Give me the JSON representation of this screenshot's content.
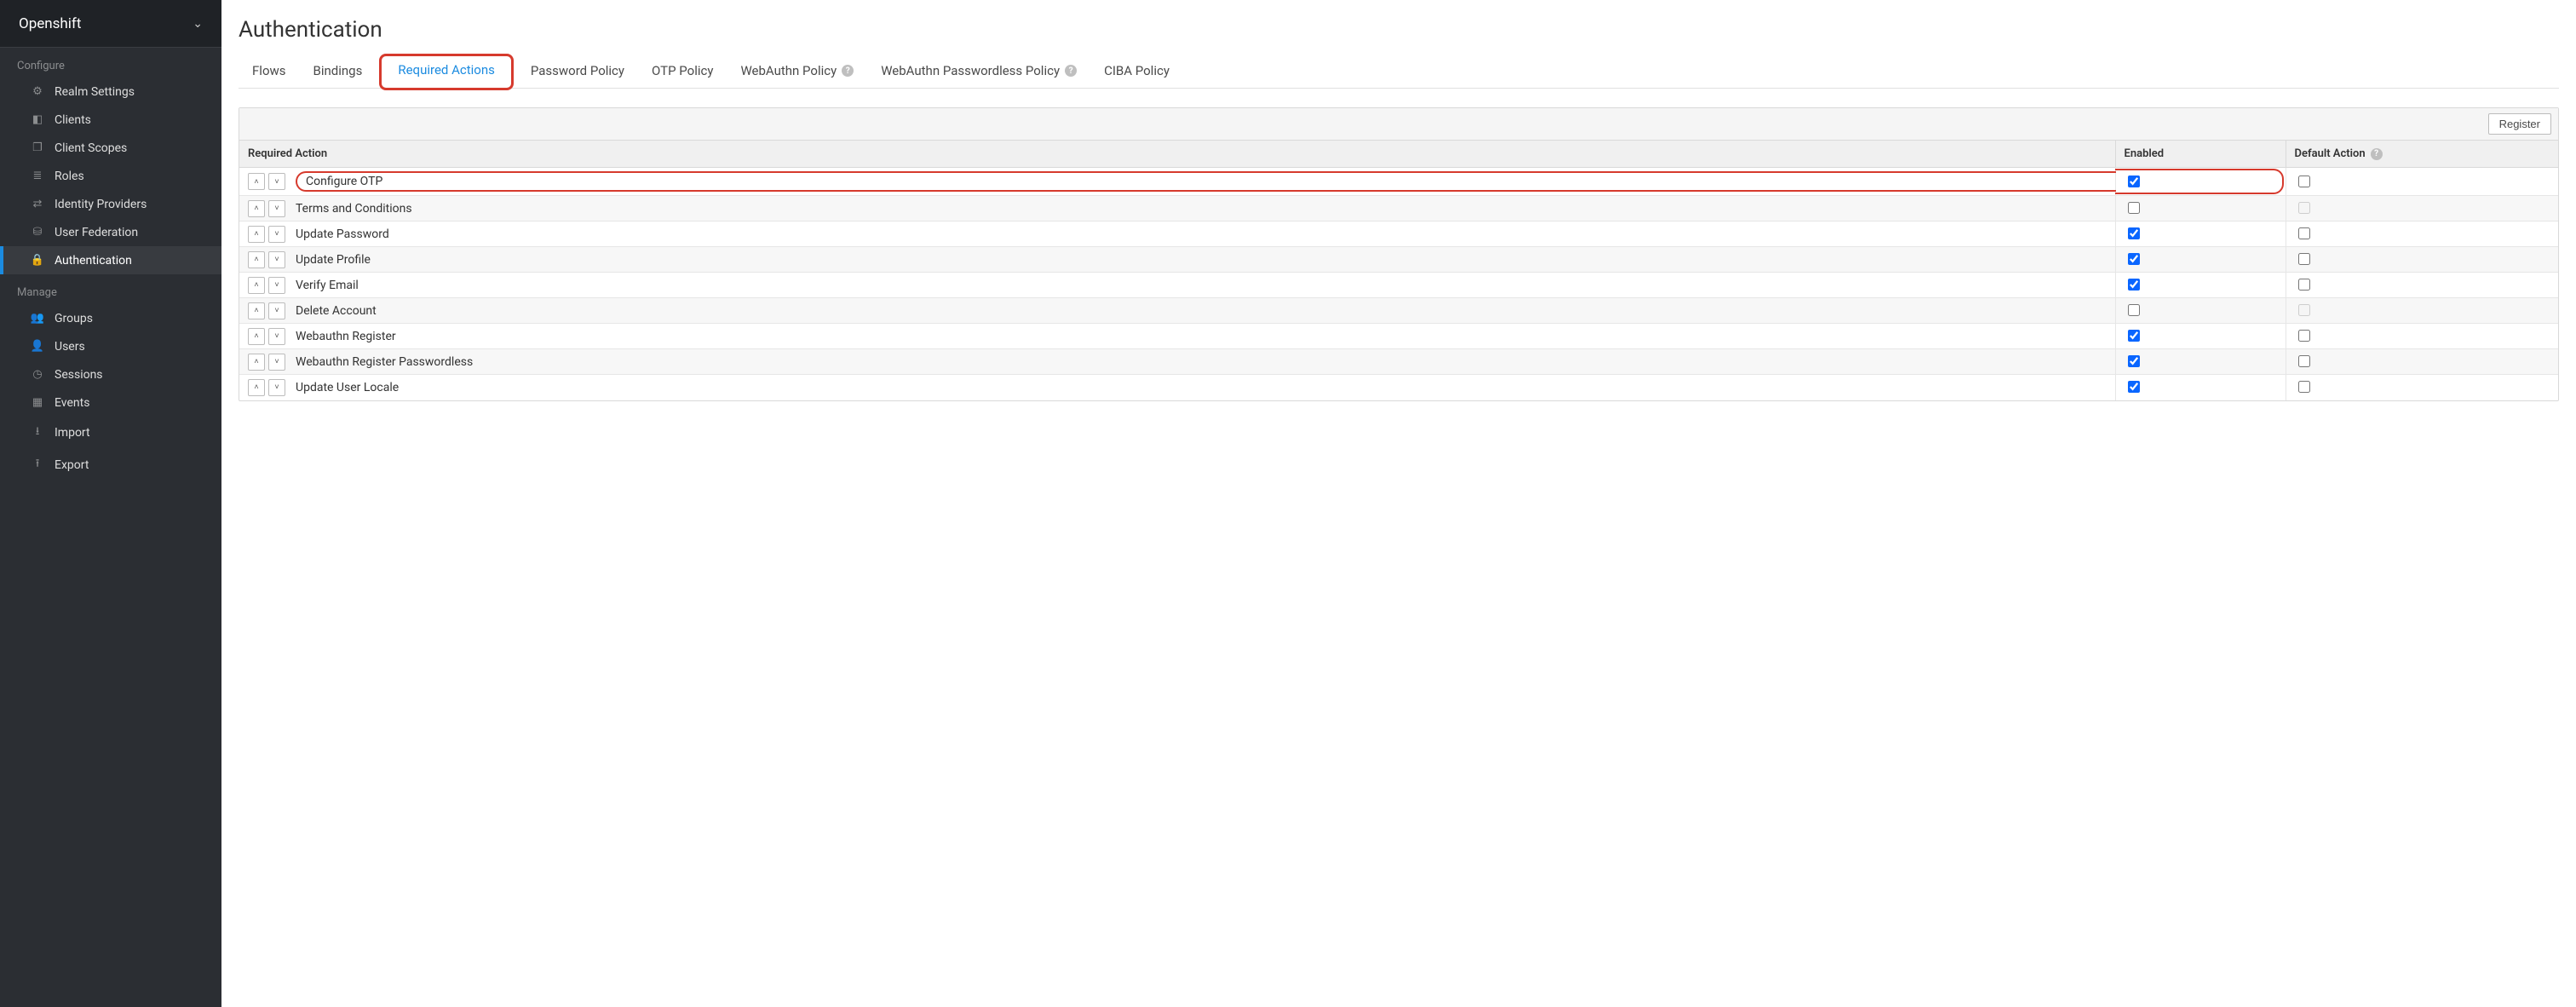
{
  "realm": {
    "name": "Openshift"
  },
  "sidebar": {
    "sections": [
      {
        "label": "Configure",
        "items": [
          {
            "label": "Realm Settings",
            "icon": "sliders"
          },
          {
            "label": "Clients",
            "icon": "cube"
          },
          {
            "label": "Client Scopes",
            "icon": "scopes"
          },
          {
            "label": "Roles",
            "icon": "list"
          },
          {
            "label": "Identity Providers",
            "icon": "exchange"
          },
          {
            "label": "User Federation",
            "icon": "database"
          },
          {
            "label": "Authentication",
            "icon": "lock",
            "active": true
          }
        ]
      },
      {
        "label": "Manage",
        "items": [
          {
            "label": "Groups",
            "icon": "users"
          },
          {
            "label": "Users",
            "icon": "user"
          },
          {
            "label": "Sessions",
            "icon": "clock"
          },
          {
            "label": "Events",
            "icon": "calendar"
          },
          {
            "label": "Import",
            "icon": "import"
          },
          {
            "label": "Export",
            "icon": "export"
          }
        ]
      }
    ]
  },
  "page": {
    "title": "Authentication"
  },
  "tabs": [
    {
      "label": "Flows"
    },
    {
      "label": "Bindings"
    },
    {
      "label": "Required Actions",
      "active": true,
      "highlighted": true
    },
    {
      "label": "Password Policy"
    },
    {
      "label": "OTP Policy"
    },
    {
      "label": "WebAuthn Policy",
      "help": true
    },
    {
      "label": "WebAuthn Passwordless Policy",
      "help": true
    },
    {
      "label": "CIBA Policy"
    }
  ],
  "toolbar": {
    "register": "Register"
  },
  "table": {
    "headers": {
      "action": "Required Action",
      "enabled": "Enabled",
      "defaultAction": "Default Action"
    },
    "rows": [
      {
        "name": "Configure OTP",
        "enabled": true,
        "defaultAction": false,
        "defaultDisabled": false,
        "highlighted": true
      },
      {
        "name": "Terms and Conditions",
        "enabled": false,
        "defaultAction": false,
        "defaultDisabled": true
      },
      {
        "name": "Update Password",
        "enabled": true,
        "defaultAction": false,
        "defaultDisabled": false
      },
      {
        "name": "Update Profile",
        "enabled": true,
        "defaultAction": false,
        "defaultDisabled": false
      },
      {
        "name": "Verify Email",
        "enabled": true,
        "defaultAction": false,
        "defaultDisabled": false
      },
      {
        "name": "Delete Account",
        "enabled": false,
        "defaultAction": false,
        "defaultDisabled": true
      },
      {
        "name": "Webauthn Register",
        "enabled": true,
        "defaultAction": false,
        "defaultDisabled": false
      },
      {
        "name": "Webauthn Register Passwordless",
        "enabled": true,
        "defaultAction": false,
        "defaultDisabled": false
      },
      {
        "name": "Update User Locale",
        "enabled": true,
        "defaultAction": false,
        "defaultDisabled": false
      }
    ]
  },
  "icons": {
    "sliders": "⚙",
    "cube": "◧",
    "scopes": "❐",
    "list": "≣",
    "exchange": "⇄",
    "database": "⛁",
    "lock": "🔒",
    "users": "👥",
    "user": "👤",
    "clock": "◷",
    "calendar": "▦",
    "import": "⭳",
    "export": "⭱",
    "chevron-down": "⌄",
    "chevron-up-sm": "˄",
    "chevron-down-sm": "˅"
  }
}
